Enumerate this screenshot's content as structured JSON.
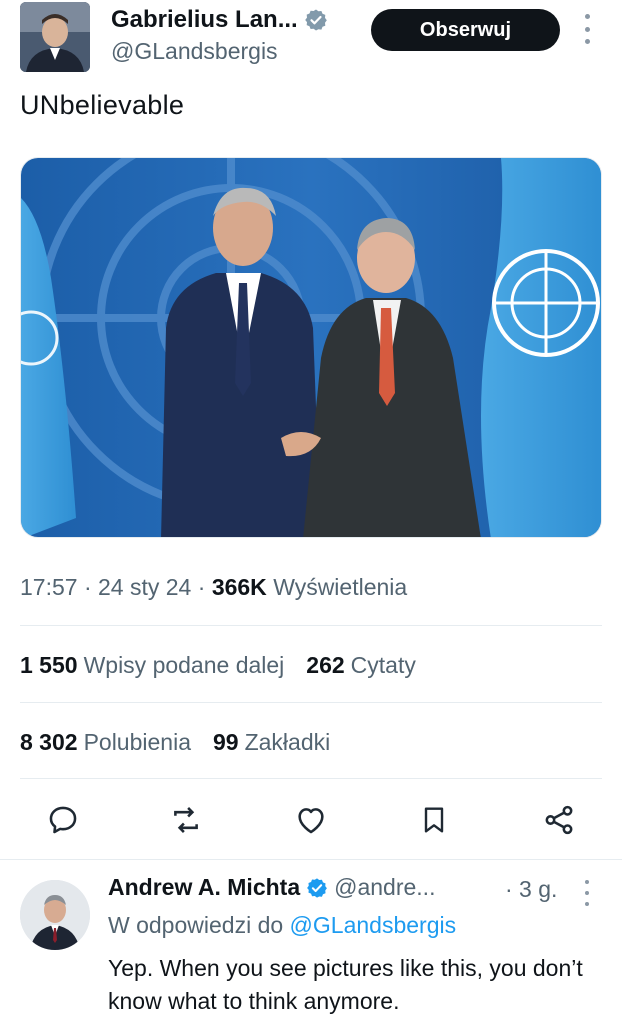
{
  "author": {
    "display_name": "Gabrielius Lan...",
    "handle": "@GLandsbergis",
    "verified": true,
    "avatar_icon": "profile-photo"
  },
  "follow_button": {
    "label": "Obserwuj"
  },
  "tweet": {
    "text": "UNbelievable",
    "media_icon": "photo-un-handshake"
  },
  "meta": {
    "time": "17:57",
    "date": "24 sty 24",
    "separator": "·",
    "views_count": "366K",
    "views_label": "Wyświetlenia"
  },
  "stats": {
    "retweets_count": "1 550",
    "retweets_label": "Wpisy podane dalej",
    "quotes_count": "262",
    "quotes_label": "Cytaty",
    "likes_count": "8 302",
    "likes_label": "Polubienia",
    "bookmarks_count": "99",
    "bookmarks_label": "Zakładki"
  },
  "actions": [
    {
      "name": "reply",
      "icon": "comment-icon"
    },
    {
      "name": "retweet",
      "icon": "retweet-icon"
    },
    {
      "name": "like",
      "icon": "heart-icon"
    },
    {
      "name": "bookmark",
      "icon": "bookmark-icon"
    },
    {
      "name": "share",
      "icon": "share-icon"
    }
  ],
  "reply": {
    "display_name": "Andrew A. Michta",
    "handle": "@andre...",
    "time": "· 3 g.",
    "verified": true,
    "replying_to_prefix": "W odpowiedzi do",
    "replying_to_handle": "@GLandsbergis",
    "text": "Yep. When you see pictures like this, you don’t know what to think anymore."
  },
  "colors": {
    "text_primary": "#0f1419",
    "text_secondary": "#536471",
    "accent_blue": "#1d9bf0",
    "follow_bg": "#0f1419",
    "un_blue": "#2b8fd6"
  }
}
